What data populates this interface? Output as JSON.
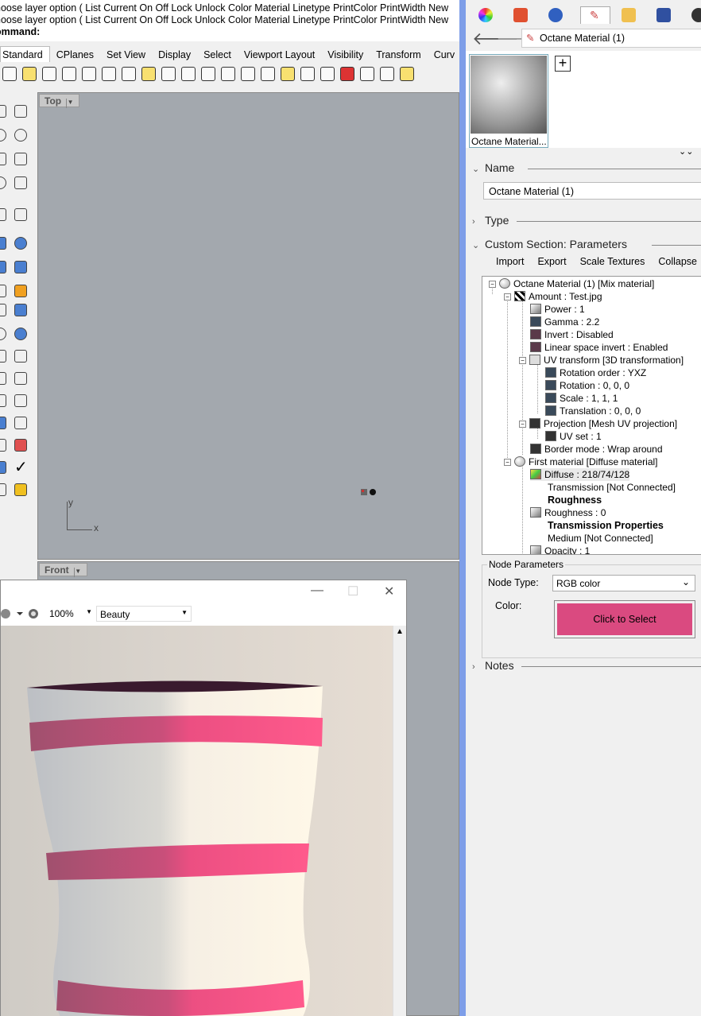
{
  "command": {
    "history_1": "hoose layer option ( List  Current  On  Off  Lock  Unlock  Color  Material  Linetype  PrintColor  PrintWidth  New",
    "history_2": "hoose layer option ( List  Current  On  Off  Lock  Unlock  Color  Material  Linetype  PrintColor  PrintWidth  New",
    "prompt": "ommand:"
  },
  "tabs": [
    "Standard",
    "CPlanes",
    "Set View",
    "Display",
    "Select",
    "Viewport Layout",
    "Visibility",
    "Transform",
    "Curv"
  ],
  "viewports": {
    "top": {
      "label": "Top"
    },
    "front": {
      "label": "Front"
    },
    "axis_y": "y",
    "axis_x": "x"
  },
  "render_window": {
    "zoom": "100%",
    "pass": "Beauty",
    "controls": {
      "minimize": "—",
      "maximize": "☐",
      "close": "✕"
    }
  },
  "right_panel": {
    "breadcrumb": "Octane Material (1)",
    "thumbnail_caption": "Octane Material...",
    "add_label": "+",
    "sections": {
      "name_title": "Name",
      "name_value": "Octane Material (1)",
      "type_title": "Type",
      "custom_title": "Custom Section: Parameters",
      "notes_title": "Notes"
    },
    "custom_buttons": [
      "Import",
      "Export",
      "Scale Textures",
      "Collapse"
    ],
    "tree": [
      "Octane Material (1)  [Mix material]",
      "Amount : Test.jpg",
      "Power : 1",
      "Gamma : 2.2",
      "Invert : Disabled",
      "Linear space invert : Enabled",
      "UV transform  [3D transformation]",
      "Rotation order : YXZ",
      "Rotation : 0, 0, 0",
      "Scale : 1, 1, 1",
      "Translation : 0, 0, 0",
      "Projection  [Mesh UV projection]",
      "UV set : 1",
      "Border mode : Wrap around",
      "First material  [Diffuse material]",
      "Diffuse : 218/74/128",
      "Transmission  [Not Connected]",
      "Roughness",
      "Roughness : 0",
      "Transmission Properties",
      "Medium  [Not Connected]",
      "Opacity : 1"
    ],
    "node_params": {
      "title": "Node Parameters",
      "type_label": "Node Type:",
      "type_value": "RGB color",
      "color_label": "Color:",
      "color_button": "Click to Select",
      "color_hex": "#da4a80"
    }
  },
  "colors": {
    "accent_border": "#7e9ee8",
    "viewport": "#a3a8ae",
    "stripe": "#e8457a"
  }
}
